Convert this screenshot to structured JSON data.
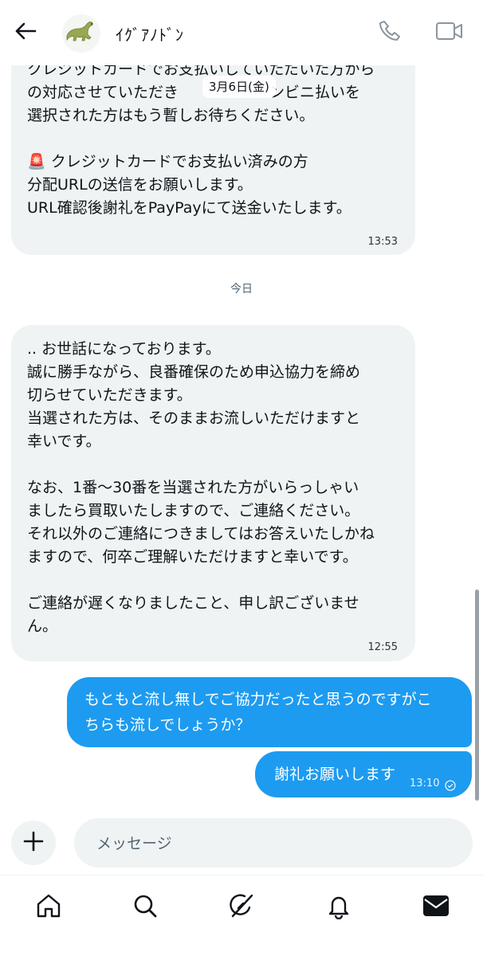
{
  "header": {
    "contact_name": "ｲｸﾞｱﾉﾄﾞﾝ",
    "icons": [
      "back-arrow-icon",
      "dinosaur-avatar",
      "phone-icon",
      "video-camera-icon"
    ]
  },
  "conversation": {
    "messages": [
      {
        "direction": "incoming",
        "text": "クレジットカードでお支払いしていただいた方から\nの対応させていただき　　　　　　ンビニ払いを\n選択された方はもう暫しお待ちください。\n\n🚨 クレジットカードでお支払い済みの方\n分配URLの送信をお願いします。\nURL確認後謝礼をPayPayにて送金いたします。",
        "time": "13:53"
      },
      {
        "direction": "incoming",
        "text": ".. お世話になっております。\n誠に勝手ながら、良番確保のため申込協力を締め\n切らせていただきます。\n当選された方は、そのままお流しいただけますと\n幸いです。\n\nなお、1番〜30番を当選された方がいらっしゃい\nましたら買取いたしますので、ご連絡ください。\nそれ以外のご連絡につきましてはお答えいたしかね\nますので、何卒ご理解いただけますと幸いです。\n\nご連絡が遅くなりましたこと、申し訳ございませ\nん。",
        "time": "12:55"
      },
      {
        "direction": "outgoing",
        "text": "もともと流し無しでご協力だったと思うのですがこ\nちらも流しでしょうか？"
      },
      {
        "direction": "outgoing",
        "text": "謝礼お願いします",
        "time": "13:10",
        "status_icon": "sent-check-icon"
      }
    ],
    "floating_date": "3月6日(金)",
    "date_separator": "今日"
  },
  "composer": {
    "placeholder": "メッセージ",
    "add_icon": "plus-icon"
  },
  "bottom_nav": {
    "items": [
      "home-icon",
      "search-icon",
      "grok-icon",
      "notifications-bell-icon",
      "messages-envelope-icon"
    ],
    "active": "messages-envelope-icon"
  },
  "colors": {
    "accent": "#1d9bf0",
    "incoming_bubble": "#eff3f4",
    "text": "#0f1419",
    "muted": "#536471"
  }
}
